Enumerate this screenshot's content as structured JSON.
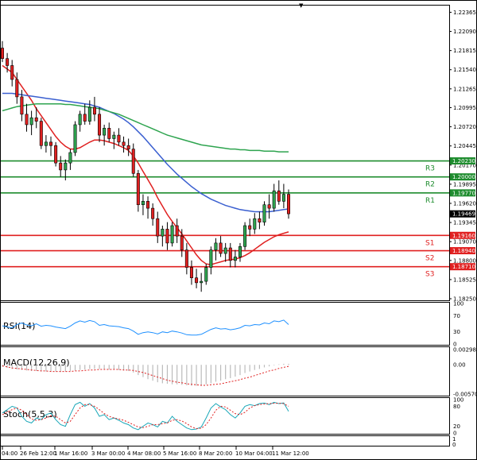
{
  "chart_data": {
    "type": "candlestick",
    "price_axis": {
      "ticks": [
        "1.22365",
        "1.22090",
        "1.21815",
        "1.21540",
        "1.21265",
        "1.20995",
        "1.20720",
        "1.20445",
        "1.20170",
        "1.19895",
        "1.19620",
        "1.19345",
        "1.19070",
        "1.18800",
        "1.18525",
        "1.18250"
      ],
      "range": [
        1.1825,
        1.2245
      ]
    },
    "current_price": {
      "label": "1.19469",
      "value": 1.19469
    },
    "levels": [
      {
        "name": "R3",
        "value": 1.2023,
        "label": "1.20230",
        "color": "#1e8c2e"
      },
      {
        "name": "R2",
        "value": 1.2,
        "label": "1.20000",
        "color": "#1e8c2e"
      },
      {
        "name": "R1",
        "value": 1.1977,
        "label": "1.19770",
        "color": "#1e8c2e"
      },
      {
        "name": "S1",
        "value": 1.1916,
        "label": "1.19160",
        "color": "#e02020"
      },
      {
        "name": "S2",
        "value": 1.1894,
        "label": "1.18940",
        "color": "#e02020"
      },
      {
        "name": "S3",
        "value": 1.1871,
        "label": "1.18710",
        "color": "#e02020"
      }
    ],
    "time_labels": [
      "04:00",
      "26 Feb 12:00",
      "1 Mar 16:00",
      "3 Mar 00:00",
      "4 Mar 08:00",
      "5 Mar 16:00",
      "8 Mar 20:00",
      "10 Mar 04:00",
      "11 Mar 12:00"
    ],
    "candles": [
      [
        1.2185,
        1.2195,
        1.2165,
        1.217
      ],
      [
        1.217,
        1.2178,
        1.215,
        1.216
      ],
      [
        1.216,
        1.2168,
        1.213,
        1.214
      ],
      [
        1.214,
        1.215,
        1.2105,
        1.2115
      ],
      [
        1.2115,
        1.2125,
        1.208,
        1.209
      ],
      [
        1.209,
        1.2105,
        1.2065,
        1.2075
      ],
      [
        1.2075,
        1.2095,
        1.206,
        1.2085
      ],
      [
        1.2085,
        1.21,
        1.207,
        1.208
      ],
      [
        1.208,
        1.2085,
        1.204,
        1.2045
      ],
      [
        1.2045,
        1.206,
        1.2035,
        1.205
      ],
      [
        1.205,
        1.2058,
        1.203,
        1.2045
      ],
      [
        1.2045,
        1.205,
        1.2015,
        1.202
      ],
      [
        1.202,
        1.203,
        1.2,
        1.201
      ],
      [
        1.201,
        1.2025,
        1.1995,
        1.202
      ],
      [
        1.202,
        1.204,
        1.201,
        1.2035
      ],
      [
        1.2035,
        1.208,
        1.203,
        1.2075
      ],
      [
        1.2075,
        1.2095,
        1.2065,
        1.209
      ],
      [
        1.209,
        1.2105,
        1.2075,
        1.208
      ],
      [
        1.208,
        1.211,
        1.2075,
        1.21
      ],
      [
        1.21,
        1.2115,
        1.208,
        1.209
      ],
      [
        1.209,
        1.21,
        1.205,
        1.206
      ],
      [
        1.206,
        1.2075,
        1.2045,
        1.207
      ],
      [
        1.207,
        1.2078,
        1.205,
        1.2055
      ],
      [
        1.2055,
        1.2065,
        1.204,
        1.206
      ],
      [
        1.206,
        1.207,
        1.2045,
        1.205
      ],
      [
        1.205,
        1.2058,
        1.2035,
        1.2045
      ],
      [
        1.2045,
        1.2055,
        1.203,
        1.204
      ],
      [
        1.204,
        1.2048,
        1.2,
        1.2005
      ],
      [
        1.2005,
        1.201,
        1.195,
        1.196
      ],
      [
        1.196,
        1.1975,
        1.1945,
        1.1965
      ],
      [
        1.1965,
        1.1972,
        1.194,
        1.1955
      ],
      [
        1.1955,
        1.1962,
        1.193,
        1.194
      ],
      [
        1.194,
        1.195,
        1.1905,
        1.1915
      ],
      [
        1.1915,
        1.193,
        1.19,
        1.1925
      ],
      [
        1.1925,
        1.1935,
        1.1895,
        1.1905
      ],
      [
        1.1905,
        1.1935,
        1.19,
        1.193
      ],
      [
        1.193,
        1.194,
        1.1905,
        1.1915
      ],
      [
        1.1915,
        1.1925,
        1.1885,
        1.1895
      ],
      [
        1.1895,
        1.1905,
        1.186,
        1.187
      ],
      [
        1.187,
        1.188,
        1.1845,
        1.1855
      ],
      [
        1.1855,
        1.1868,
        1.184,
        1.1848
      ],
      [
        1.1848,
        1.1862,
        1.1835,
        1.185
      ],
      [
        1.185,
        1.1875,
        1.1845,
        1.187
      ],
      [
        1.187,
        1.19,
        1.186,
        1.1895
      ],
      [
        1.1895,
        1.1912,
        1.188,
        1.1905
      ],
      [
        1.1905,
        1.1915,
        1.1885,
        1.189
      ],
      [
        1.189,
        1.1905,
        1.1878,
        1.1898
      ],
      [
        1.1898,
        1.1905,
        1.187,
        1.188
      ],
      [
        1.188,
        1.1895,
        1.187,
        1.1885
      ],
      [
        1.1885,
        1.1905,
        1.1878,
        1.19
      ],
      [
        1.19,
        1.1935,
        1.1895,
        1.193
      ],
      [
        1.193,
        1.194,
        1.1915,
        1.1925
      ],
      [
        1.1925,
        1.1948,
        1.1918,
        1.194
      ],
      [
        1.194,
        1.195,
        1.1925,
        1.1935
      ],
      [
        1.1935,
        1.1965,
        1.193,
        1.196
      ],
      [
        1.196,
        1.1975,
        1.194,
        1.1955
      ],
      [
        1.1955,
        1.199,
        1.195,
        1.198
      ],
      [
        1.198,
        1.1995,
        1.196,
        1.1965
      ],
      [
        1.1965,
        1.199,
        1.1955,
        1.1975
      ],
      [
        1.1975,
        1.1982,
        1.194,
        1.1947
      ]
    ],
    "ma_series": [
      {
        "color": "#e02020",
        "values": [
          1.216,
          1.2155,
          1.215,
          1.214,
          1.213,
          1.212,
          1.211,
          1.2098,
          1.2088,
          1.2078,
          1.2068,
          1.2058,
          1.205,
          1.2044,
          1.204,
          1.204,
          1.2042,
          1.2046,
          1.205,
          1.2053,
          1.2053,
          1.2052,
          1.205,
          1.2048,
          1.2045,
          1.2042,
          1.2038,
          1.203,
          1.202,
          1.2008,
          1.1996,
          1.1984,
          1.197,
          1.1958,
          1.1946,
          1.1936,
          1.1927,
          1.1918,
          1.1908,
          1.1898,
          1.1888,
          1.188,
          1.1875,
          1.1874,
          1.1876,
          1.1878,
          1.188,
          1.1881,
          1.1882,
          1.1884,
          1.1887,
          1.1891,
          1.1896,
          1.1901,
          1.1906,
          1.191,
          1.1914,
          1.1917,
          1.1919,
          1.1921
        ]
      },
      {
        "color": "#3a5fd0",
        "values": [
          1.212,
          1.212,
          1.212,
          1.2119,
          1.2118,
          1.2117,
          1.2116,
          1.2115,
          1.2114,
          1.2113,
          1.2112,
          1.2111,
          1.211,
          1.2109,
          1.2108,
          1.2107,
          1.2106,
          1.2105,
          1.2104,
          1.2102,
          1.21,
          1.2097,
          1.2094,
          1.2091,
          1.2087,
          1.2083,
          1.2078,
          1.2072,
          1.2065,
          1.2058,
          1.205,
          1.2042,
          1.2034,
          1.2026,
          1.2018,
          1.2011,
          1.2004,
          1.1998,
          1.1992,
          1.1986,
          1.1981,
          1.1976,
          1.1972,
          1.1968,
          1.1965,
          1.1962,
          1.1959,
          1.1957,
          1.1955,
          1.1953,
          1.1952,
          1.1951,
          1.195,
          1.195,
          1.195,
          1.195,
          1.1951,
          1.1952,
          1.1953,
          1.1954
        ]
      },
      {
        "color": "#2ea44f",
        "values": [
          1.2095,
          1.2097,
          1.2099,
          1.2101,
          1.2102,
          1.2103,
          1.2104,
          1.2105,
          1.2105,
          1.2105,
          1.2105,
          1.2105,
          1.2105,
          1.2104,
          1.2104,
          1.2103,
          1.2102,
          1.2101,
          1.21,
          1.2099,
          1.2098,
          1.2096,
          1.2094,
          1.2092,
          1.209,
          1.2087,
          1.2084,
          1.2081,
          1.2078,
          1.2075,
          1.2072,
          1.2069,
          1.2066,
          1.2063,
          1.206,
          1.2058,
          1.2056,
          1.2054,
          1.2052,
          1.205,
          1.2048,
          1.2046,
          1.2045,
          1.2044,
          1.2043,
          1.2042,
          1.2041,
          1.204,
          1.204,
          1.2039,
          1.2039,
          1.2038,
          1.2038,
          1.2038,
          1.2037,
          1.2037,
          1.2037,
          1.2036,
          1.2036,
          1.2036
        ]
      }
    ],
    "rsi": {
      "title": "RSI(14)",
      "ticks": [
        "100",
        "70",
        "30",
        "0"
      ],
      "values": [
        45,
        42,
        40,
        48,
        52,
        47,
        45,
        50,
        44,
        46,
        45,
        42,
        40,
        38,
        44,
        52,
        57,
        54,
        58,
        55,
        46,
        48,
        45,
        44,
        43,
        40,
        38,
        32,
        24,
        28,
        30,
        28,
        25,
        30,
        28,
        32,
        30,
        27,
        23,
        22,
        22,
        24,
        30,
        36,
        40,
        37,
        38,
        35,
        37,
        40,
        46,
        45,
        48,
        47,
        52,
        50,
        57,
        55,
        59,
        48
      ]
    },
    "macd": {
      "title": "MACD(12,26,9)",
      "ticks": [
        "0.002981",
        "0.00",
        "-0.005708"
      ],
      "range": [
        -0.005708,
        0.002981
      ],
      "hist": [
        -0.0004,
        -0.0006,
        -0.0008,
        -0.0009,
        -0.001,
        -0.0011,
        -0.0012,
        -0.0012,
        -0.0013,
        -0.0013,
        -0.0013,
        -0.0013,
        -0.0014,
        -0.0013,
        -0.0012,
        -0.0011,
        -0.001,
        -0.0009,
        -0.0008,
        -0.0008,
        -0.0008,
        -0.0008,
        -0.0009,
        -0.0009,
        -0.001,
        -0.0011,
        -0.0012,
        -0.0015,
        -0.002,
        -0.0024,
        -0.0028,
        -0.0031,
        -0.0034,
        -0.0036,
        -0.0037,
        -0.0038,
        -0.0038,
        -0.0039,
        -0.004,
        -0.0041,
        -0.0041,
        -0.004,
        -0.0038,
        -0.0036,
        -0.0033,
        -0.0031,
        -0.0028,
        -0.0026,
        -0.0023,
        -0.002,
        -0.0016,
        -0.0013,
        -0.001,
        -0.0008,
        -0.0005,
        -0.0003,
        -0.0001,
        0.0001,
        0.0002,
        0.0002
      ],
      "signal": [
        -0.0002,
        -0.0004,
        -0.0006,
        -0.0007,
        -0.0008,
        -0.0009,
        -0.001,
        -0.0011,
        -0.0012,
        -0.0012,
        -0.0013,
        -0.0013,
        -0.0013,
        -0.0013,
        -0.0013,
        -0.0012,
        -0.0012,
        -0.0011,
        -0.001,
        -0.001,
        -0.0009,
        -0.0009,
        -0.0009,
        -0.0009,
        -0.0009,
        -0.001,
        -0.001,
        -0.0011,
        -0.0013,
        -0.0015,
        -0.0018,
        -0.0021,
        -0.0024,
        -0.0027,
        -0.003,
        -0.0032,
        -0.0034,
        -0.0035,
        -0.0037,
        -0.0038,
        -0.0039,
        -0.004,
        -0.004,
        -0.0039,
        -0.0038,
        -0.0037,
        -0.0035,
        -0.0033,
        -0.0031,
        -0.0029,
        -0.0026,
        -0.0024,
        -0.0021,
        -0.0018,
        -0.0015,
        -0.0012,
        -0.001,
        -0.0007,
        -0.0005,
        -0.0003
      ]
    },
    "stoch": {
      "title": "Stoch(5,5,3)",
      "ticks": [
        "100",
        "80",
        "20",
        "0"
      ],
      "k": [
        60,
        70,
        80,
        75,
        50,
        35,
        30,
        45,
        40,
        55,
        60,
        40,
        25,
        20,
        55,
        85,
        92,
        80,
        88,
        75,
        50,
        55,
        40,
        45,
        38,
        30,
        25,
        15,
        10,
        20,
        30,
        25,
        18,
        35,
        30,
        50,
        35,
        25,
        15,
        10,
        12,
        18,
        45,
        75,
        88,
        78,
        70,
        55,
        45,
        60,
        80,
        85,
        82,
        88,
        90,
        85,
        92,
        88,
        90,
        65
      ],
      "d": [
        55,
        62,
        70,
        75,
        68,
        55,
        42,
        38,
        40,
        45,
        52,
        50,
        40,
        30,
        35,
        55,
        75,
        85,
        85,
        80,
        70,
        58,
        50,
        45,
        42,
        38,
        32,
        25,
        18,
        16,
        20,
        25,
        25,
        28,
        30,
        38,
        40,
        36,
        28,
        18,
        13,
        14,
        25,
        45,
        68,
        80,
        78,
        68,
        58,
        55,
        62,
        75,
        82,
        85,
        87,
        88,
        89,
        89,
        88,
        80
      ]
    }
  }
}
